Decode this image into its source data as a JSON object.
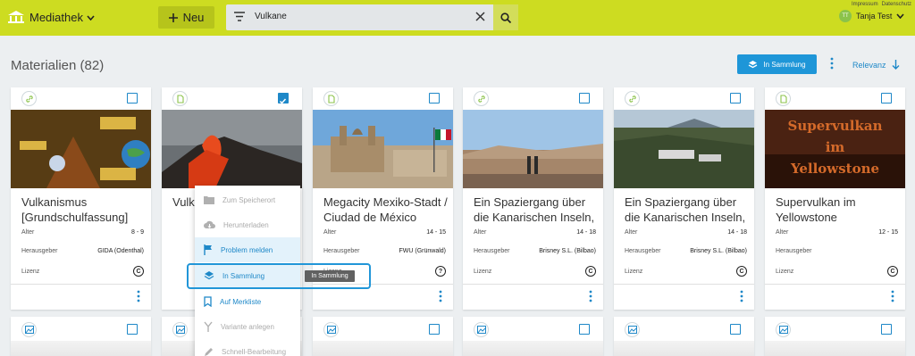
{
  "header": {
    "app_title": "Mediathek",
    "new_label": "Neu",
    "search_value": "Vulkane",
    "link_imprint": "Impressum",
    "link_privacy": "Datenschutz",
    "user_initials": "TT",
    "user_name": "Tanja Test"
  },
  "toolbar": {
    "title": "Materialien (82)",
    "collection_button": "In Sammlung",
    "sort_label": "Relevanz"
  },
  "labels": {
    "age": "Alter",
    "publisher": "Herausgeber",
    "license": "Lizenz"
  },
  "cards": [
    {
      "title": "Vulkanismus [Grundschulfassung]",
      "age": "8 - 9",
      "publisher": "GIDA (Odenthal)",
      "icon": "link-icon",
      "checked": false
    },
    {
      "title": "Vulk... Phän...",
      "age": "",
      "publisher": "",
      "icon": "document-icon",
      "checked": true
    },
    {
      "title": "Megacity Mexiko-Stadt / Ciudad de México",
      "age": "14 - 15",
      "publisher": "FWU (Grünwald)",
      "icon": "document-icon",
      "checked": false
    },
    {
      "title": "Ein Spaziergang über die Kanarischen Inseln, Teil ...",
      "age": "14 - 18",
      "publisher": "Brisney S.L. (Bilbao)",
      "icon": "link-icon",
      "checked": false
    },
    {
      "title": "Ein Spaziergang über die Kanarischen Inseln, Teil I",
      "age": "14 - 18",
      "publisher": "Brisney S.L. (Bilbao)",
      "icon": "link-icon",
      "checked": false
    },
    {
      "title": "Supervulkan im Yellowstone",
      "age": "12 - 15",
      "publisher": "",
      "icon": "document-icon",
      "checked": false
    }
  ],
  "menu": {
    "items": [
      {
        "label": "Zum Speicherort",
        "icon": "folder-icon",
        "state": "disabled"
      },
      {
        "label": "Herunterladen",
        "icon": "cloud-download-icon",
        "state": "disabled"
      },
      {
        "label": "Problem melden",
        "icon": "flag-icon",
        "state": "active"
      },
      {
        "label": "In Sammlung",
        "icon": "layers-icon",
        "state": "active"
      },
      {
        "label": "Auf Merkliste",
        "icon": "bookmark-icon",
        "state": "active"
      },
      {
        "label": "Variante anlegen",
        "icon": "fork-icon",
        "state": "disabled"
      },
      {
        "label": "Schnell-Bearbeitung",
        "icon": "edit-icon",
        "state": "disabled"
      }
    ],
    "tooltip": "In Sammlung"
  },
  "thumb_texts": {
    "yellowstone_line1": "Supervulkan",
    "yellowstone_line2": "im",
    "yellowstone_line3": "Yellowstone"
  },
  "colors": {
    "accent": "#cddc21",
    "primary": "#1e88c8"
  }
}
